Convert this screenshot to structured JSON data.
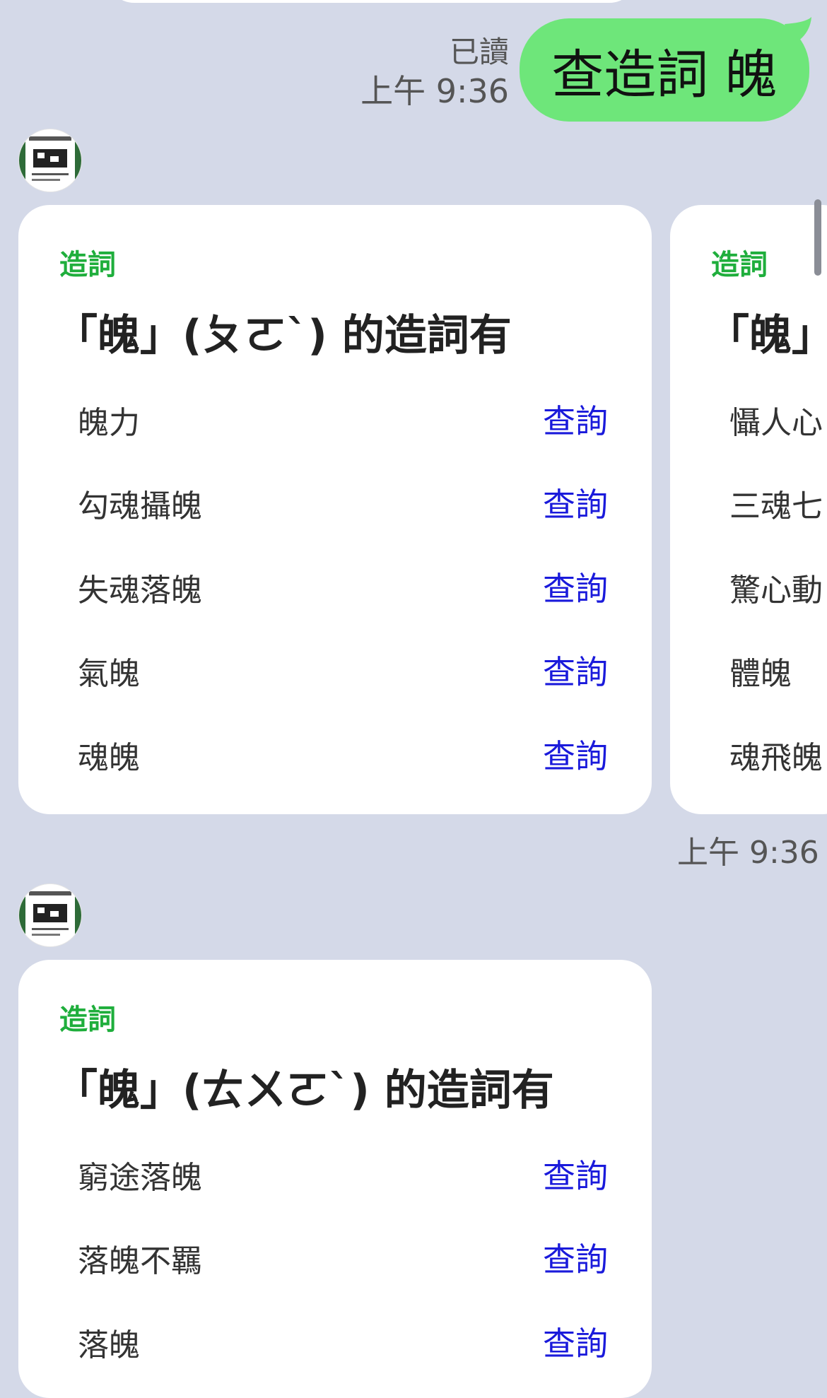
{
  "sent": {
    "read_label": "已讀",
    "time": "上午 9:36",
    "message": "查造詞 魄"
  },
  "carousel1": {
    "cards": [
      {
        "tag": "造詞",
        "title": "「魄」(ㄆㄛˋ) 的造詞有",
        "rows": [
          {
            "label": "魄力",
            "action": "查詢"
          },
          {
            "label": "勾魂攝魄",
            "action": "查詢"
          },
          {
            "label": "失魂落魄",
            "action": "查詢"
          },
          {
            "label": "氣魄",
            "action": "查詢"
          },
          {
            "label": "魂魄",
            "action": "查詢"
          }
        ]
      },
      {
        "tag": "造詞",
        "title": "「魄」(ㄆ",
        "rows": [
          {
            "label": "懾人心"
          },
          {
            "label": "三魂七"
          },
          {
            "label": "驚心動"
          },
          {
            "label": "體魄"
          },
          {
            "label": "魂飛魄"
          }
        ]
      }
    ],
    "time": "上午 9:36"
  },
  "carousel2": {
    "cards": [
      {
        "tag": "造詞",
        "title": "「魄」(ㄊㄨㄛˋ) 的造詞有",
        "rows": [
          {
            "label": "窮途落魄",
            "action": "查詢"
          },
          {
            "label": "落魄不羈",
            "action": "查詢"
          },
          {
            "label": "落魄",
            "action": "查詢"
          }
        ]
      }
    ]
  },
  "colors": {
    "background": "#d4d9e8",
    "sent_bubble": "#6ee67a",
    "tag_green": "#1fae3c",
    "link_blue": "#1a1adb"
  },
  "icons": {
    "avatar": "bot-avatar-icon"
  }
}
